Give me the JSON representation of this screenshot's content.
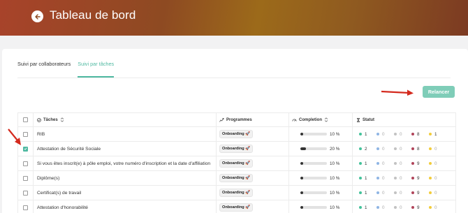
{
  "header": {
    "title": "Tableau de bord"
  },
  "tabs": [
    {
      "label": "Suivi par collaborateurs",
      "active": false
    },
    {
      "label": "Suivi par tâches",
      "active": true
    }
  ],
  "relancer_label": "Relancer",
  "colors": {
    "accent": "#4fb9a1",
    "green": "#43c29a",
    "blue": "#8fb5e4",
    "grey": "#c2c2c2",
    "red": "#b0445a",
    "yellow": "#f2cc3a"
  },
  "table": {
    "headers": {
      "tasks": "Tâches",
      "programs": "Programmes",
      "completion": "Completion",
      "status": "Statut"
    },
    "rows": [
      {
        "task": "RIB",
        "checked": false,
        "program": "Onboarding 🚀",
        "completion": "10 %",
        "completion_value": 10,
        "status": [
          "1",
          "0",
          "0",
          "8",
          "1"
        ]
      },
      {
        "task": "Attestation de Sécurité Sociale",
        "checked": true,
        "program": "Onboarding 🚀",
        "completion": "20 %",
        "completion_value": 20,
        "status": [
          "2",
          "0",
          "0",
          "8",
          "0"
        ]
      },
      {
        "task": "Si vous êtes inscrit(e) à pôle emploi, votre numéro d'inscription et la date d'affiliation",
        "checked": false,
        "program": "Onboarding 🚀",
        "completion": "10 %",
        "completion_value": 10,
        "status": [
          "1",
          "0",
          "0",
          "9",
          "0"
        ]
      },
      {
        "task": "Diplôme(s)",
        "checked": false,
        "program": "Onboarding 🚀",
        "completion": "10 %",
        "completion_value": 10,
        "status": [
          "1",
          "0",
          "0",
          "9",
          "0"
        ]
      },
      {
        "task": "Certificat(s) de travail",
        "checked": false,
        "program": "Onboarding 🚀",
        "completion": "10 %",
        "completion_value": 10,
        "status": [
          "1",
          "0",
          "0",
          "9",
          "0"
        ]
      },
      {
        "task": "Attestation d'honorabilité",
        "checked": false,
        "program": "Onboarding 🚀",
        "completion": "10 %",
        "completion_value": 10,
        "status": [
          "1",
          "0",
          "0",
          "9",
          "0"
        ]
      }
    ]
  }
}
